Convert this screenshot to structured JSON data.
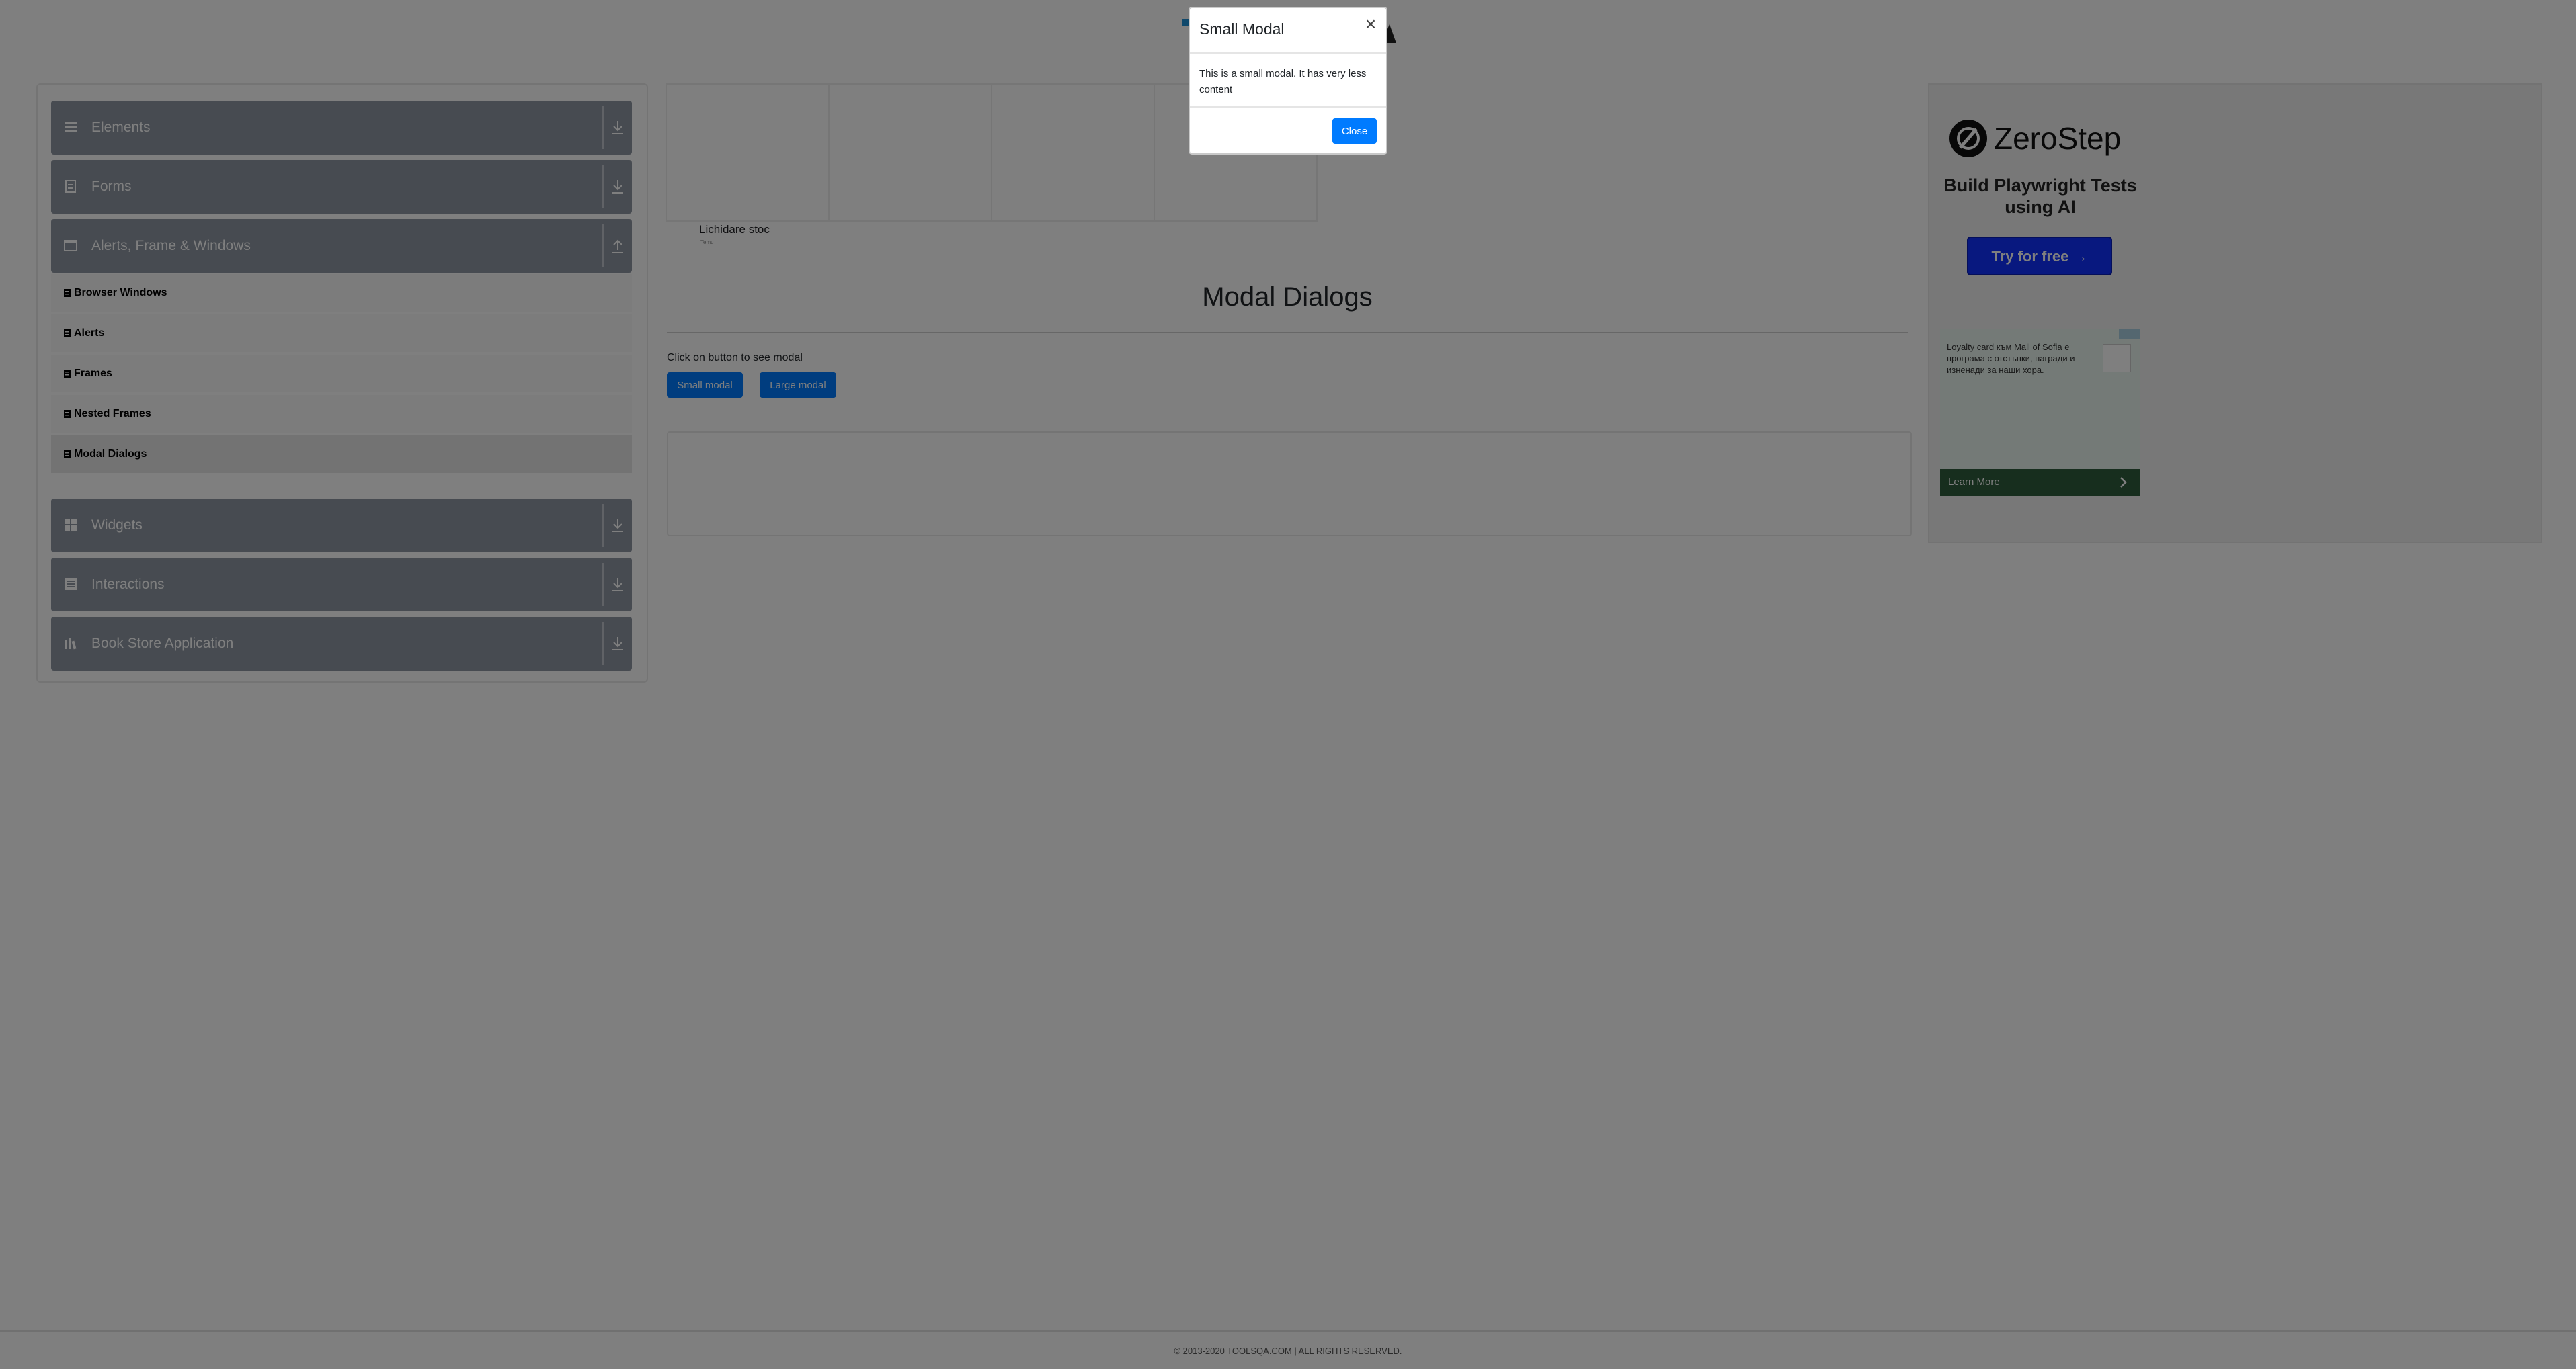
{
  "header": {
    "logo_alt": "TOOLSQA"
  },
  "sidebar": {
    "groups": [
      {
        "label": "Elements",
        "icon": "hamburger-icon",
        "expanded": false
      },
      {
        "label": "Forms",
        "icon": "document-icon",
        "expanded": false
      },
      {
        "label": "Alerts, Frame & Windows",
        "icon": "window-icon",
        "expanded": true
      },
      {
        "label": "Widgets",
        "icon": "grid-icon",
        "expanded": false
      },
      {
        "label": "Interactions",
        "icon": "interactions-icon",
        "expanded": false
      },
      {
        "label": "Book Store Application",
        "icon": "books-icon",
        "expanded": false
      }
    ],
    "sub_items": [
      {
        "label": "Browser Windows",
        "active": false
      },
      {
        "label": "Alerts",
        "active": false
      },
      {
        "label": "Frames",
        "active": false
      },
      {
        "label": "Nested Frames",
        "active": false
      },
      {
        "label": "Modal Dialogs",
        "active": true
      }
    ]
  },
  "top_ad": {
    "caption": "Lichidare stoc",
    "sub": "Temu"
  },
  "main": {
    "title": "Modal Dialogs",
    "instruction": "Click on button to see modal",
    "small_button": "Small modal",
    "large_button": "Large modal"
  },
  "right_ad": {
    "brand": "ZeroStep",
    "headline": "Build Playwright Tests using AI",
    "cta": "Try for free →",
    "ad2_text": "Loyalty card към Mall of Sofia е програма с отстъпки, награди и изненади за наши хора.",
    "ad2_link": "Learn More"
  },
  "modal": {
    "title": "Small Modal",
    "close_glyph": "×",
    "body": "This is a small modal. It has very less content",
    "close_button": "Close"
  },
  "footer": {
    "text": "© 2013-2020 TOOLSQA.COM | ALL RIGHTS RESERVED."
  },
  "colors": {
    "primary": "#007bff",
    "group_header": "#8e96a2",
    "overlay": "rgba(0,0,0,0.5)",
    "zerostep_cta": "#1030ff"
  }
}
